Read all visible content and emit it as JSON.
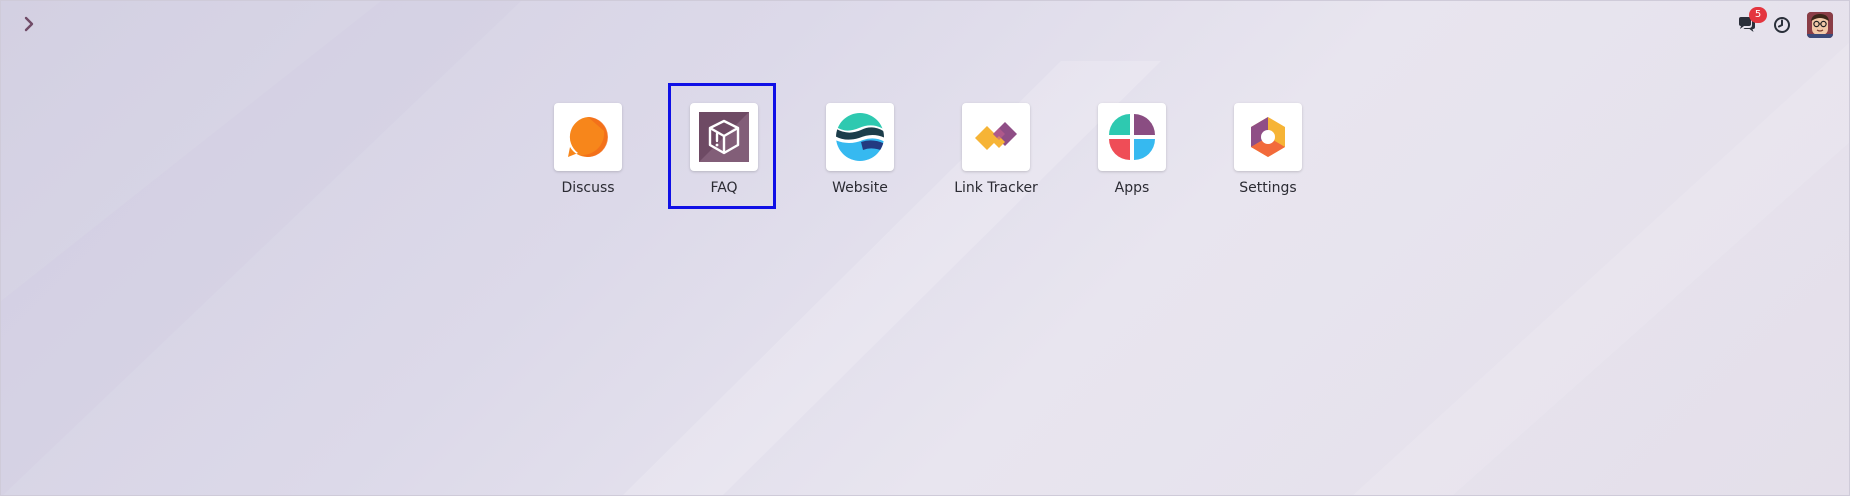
{
  "window": {
    "background_gradient": [
      "#d3d0e2",
      "#e8e5ef",
      "#e4dfea"
    ]
  },
  "topbar": {
    "menu_toggle_icon": "chevron-right-icon",
    "messages": {
      "icon": "chat-bubbles-icon",
      "badge_count": "5",
      "badge_color": "#e4353f"
    },
    "activity_icon": "clock-icon",
    "avatar_icon": "user-avatar"
  },
  "apps": [
    {
      "label": "Discuss",
      "icon": "discuss-icon",
      "selected": false
    },
    {
      "label": "FAQ",
      "icon": "faq-icon",
      "selected": true
    },
    {
      "label": "Website",
      "icon": "website-icon",
      "selected": false
    },
    {
      "label": "Link Tracker",
      "icon": "link-tracker-icon",
      "selected": false
    },
    {
      "label": "Apps",
      "icon": "apps-icon",
      "selected": false
    },
    {
      "label": "Settings",
      "icon": "settings-icon",
      "selected": false
    }
  ],
  "selection_color": "#1010e6"
}
